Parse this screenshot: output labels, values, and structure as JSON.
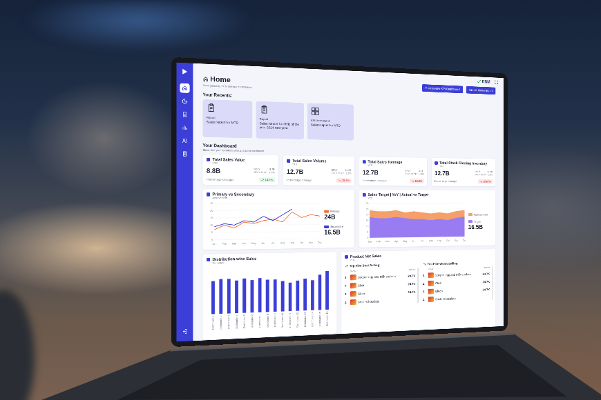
{
  "sidebar": {
    "items": [
      {
        "selected": true
      },
      {
        "selected": false
      },
      {
        "selected": false
      },
      {
        "selected": false
      },
      {
        "selected": false
      },
      {
        "selected": false
      }
    ]
  },
  "topbar": {
    "brand": "EBM"
  },
  "header": {
    "title": "Home",
    "subtitle": "Your gateway to seamless experience",
    "buttons": [
      "Create New KPI Dashboard",
      "Create New Report"
    ]
  },
  "recents": {
    "title": "Your Recents:",
    "items": [
      {
        "kind": "report",
        "type": "Report",
        "title": "Sales Report for MTD"
      },
      {
        "kind": "report",
        "type": "Report",
        "title": "Sales Report for MTD of the year 2024 next year."
      },
      {
        "kind": "kpi",
        "type": "KPI Dashboard",
        "title": "Sales Report for MTD"
      }
    ]
  },
  "dashboard": {
    "title": "Your Dashboard",
    "subtitle": "Streamline your operations with an intuitive dashboard"
  },
  "kpis": [
    {
      "title": "Total Sales Value",
      "period": "YTD",
      "value": "8.8B",
      "compare": [
        {
          "label": "SPLY",
          "value": "8.7B"
        },
        {
          "label": "SPLY % YP",
          "value": "1.5%"
        }
      ],
      "change_label": "Percentage Change:",
      "change": "14.6%",
      "trend": "up"
    },
    {
      "title": "Total Sales Volume",
      "period": "YTD",
      "value": "12.7B",
      "compare": [
        {
          "label": "SPLY",
          "value": "14.9B"
        },
        {
          "label": "SPLY % YP",
          "value": "1.5%"
        }
      ],
      "change_label": "Percentage Change:",
      "change": "15.6%",
      "trend": "down"
    },
    {
      "title": "Total Sales Tonnage",
      "period": "YTD",
      "value": "12.7B",
      "compare": [
        {
          "label": "SPLY",
          "value": "14.9B"
        },
        {
          "label": "SPLY % YP",
          "value": "1.5%"
        }
      ],
      "change_label": "Percentage Change:",
      "change": "15.6%",
      "trend": "down"
    },
    {
      "title": "Total Stock Closing Inventory",
      "period": "YTD",
      "value": "12.7B",
      "compare": [
        {
          "label": "SPLY",
          "value": "14.9B"
        },
        {
          "label": "SPLY % YP",
          "value": "1.5%"
        }
      ],
      "change_label": "Percentage Change:",
      "change": "15.67%",
      "trend": "down"
    }
  ],
  "primary_vs_secondary": {
    "title": "Primary vs Secondary",
    "subtitle": "Achievement",
    "months": [
      "Jan",
      "Feb",
      "Mar",
      "Apr",
      "May",
      "Jun",
      "Jul",
      "Aug",
      "Sep",
      "Oct",
      "Nov",
      "Dec"
    ],
    "y_ticks": [
      "0",
      "5",
      "10",
      "15",
      "20",
      "25"
    ],
    "series": [
      {
        "name": "Primary",
        "total": "24B",
        "color": "#f0733a",
        "values": [
          7,
          10,
          8,
          12,
          11,
          13,
          14,
          12,
          19,
          15,
          17,
          16
        ]
      },
      {
        "name": "Secondary",
        "total": "16.5B",
        "color": "#3e3ad6",
        "values": [
          9,
          11,
          10,
          13,
          12,
          16,
          13,
          17,
          21
        ]
      }
    ]
  },
  "sales_target": {
    "title": "Sales Target | YoY | Actual vs Target",
    "subtitle": "YTD",
    "months": [
      "Jan",
      "Feb",
      "Mar",
      "Apr",
      "May",
      "Jun",
      "Jul",
      "Aug",
      "Sep",
      "Oct",
      "Nov",
      "Dec"
    ],
    "y_ticks": [
      "0",
      "5",
      "10",
      "15",
      "20",
      "25",
      "30"
    ],
    "series": [
      {
        "name": "Achievement",
        "color": "#f5a06a",
        "values": [
          24,
          23,
          23,
          24,
          22,
          23,
          22,
          21,
          22,
          21,
          23,
          24
        ]
      },
      {
        "name": "Target",
        "total": "16.5B",
        "color": "#9a7cf2",
        "values": [
          18,
          17,
          17,
          18,
          17,
          16,
          16,
          15,
          16,
          15,
          17,
          18
        ]
      }
    ]
  },
  "distribution": {
    "title": "Distribution-wise Sales",
    "subtitle": "Top Sales",
    "max": 25,
    "bars": [
      {
        "label": "Distributor 1",
        "value": 18
      },
      {
        "label": "Distributor 2",
        "value": 19
      },
      {
        "label": "Distributor 3",
        "value": 19
      },
      {
        "label": "Distributor 4",
        "value": 18
      },
      {
        "label": "Distributor 5",
        "value": 19
      },
      {
        "label": "Distributor 6",
        "value": 18
      },
      {
        "label": "Distributor 7",
        "value": 19
      },
      {
        "label": "Distributor 8",
        "value": 18
      },
      {
        "label": "Distributor 9",
        "value": 18
      },
      {
        "label": "Distributor 10",
        "value": 17
      },
      {
        "label": "Distributor 11",
        "value": 16
      },
      {
        "label": "Distributor 12",
        "value": 17
      },
      {
        "label": "Distributor 13",
        "value": 18
      },
      {
        "label": "Distributor 14",
        "value": 17
      },
      {
        "label": "Distributor 15",
        "value": 20
      },
      {
        "label": "Distributor 16",
        "value": 22
      }
    ]
  },
  "product_net_sales": {
    "title": "Product Net Sales",
    "subtitle": "YTD",
    "lists": [
      {
        "title": "Top Five Best Selling:",
        "trend": "up",
        "columns": [
          "NAME",
          "SALES"
        ],
        "rows": [
          {
            "rank": "1",
            "name": "Sooper egg and milk cookies",
            "sales": "24.7K"
          },
          {
            "rank": "2",
            "name": "Click",
            "sales": "24.7K"
          },
          {
            "rank": "3",
            "name": "Gluco",
            "sales": "24.7K"
          },
          {
            "rank": "4",
            "name": "Smile Chocolate",
            "sales": ""
          }
        ]
      },
      {
        "title": "Top Five Worst Selling:",
        "trend": "down",
        "columns": [
          "NAME",
          "SALES"
        ],
        "rows": [
          {
            "rank": "1",
            "name": "Sooper egg and milk cookies",
            "sales": "24.7K"
          },
          {
            "rank": "2",
            "name": "Click",
            "sales": "24.7K"
          },
          {
            "rank": "3",
            "name": "Gluco",
            "sales": "24.7K"
          },
          {
            "rank": "4",
            "name": "Smile Chocolate",
            "sales": ""
          }
        ]
      }
    ]
  }
}
